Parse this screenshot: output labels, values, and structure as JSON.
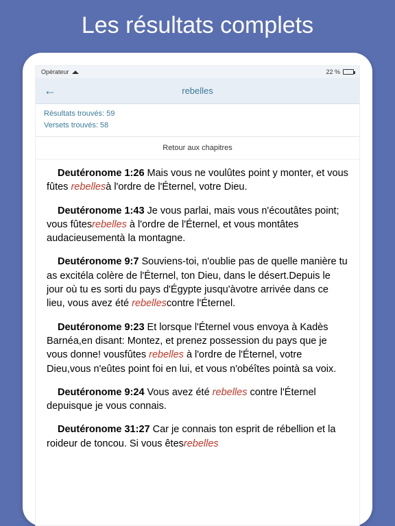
{
  "hero": {
    "title": "Les résultats complets"
  },
  "status": {
    "carrier": "Opérateur",
    "wifi": "wifi",
    "battery_text": "22 %"
  },
  "nav": {
    "back": "←",
    "title": "rebelles"
  },
  "stats": {
    "results": "Résultats trouvés: 59",
    "verses": "Versets trouvés: 58"
  },
  "return_link": "Retour aux chapitres",
  "keyword": "rebelles",
  "verses_list": [
    {
      "ref": "Deutéronome 1:26",
      "before": " Mais vous ne voulûtes point y monter, et vous fûtes ",
      "after": "à l'ordre de l'Éternel, votre Dieu."
    },
    {
      "ref": "Deutéronome 1:43",
      "before": " Je vous parlai, mais vous n'écoutâtes point; vous fûtes",
      "after": " à l'ordre de l'Éternel, et vous montâtes audacieusementà la montagne."
    },
    {
      "ref": "Deutéronome 9:7",
      "before": " Souviens-toi, n'oublie pas de quelle manière tu as excitéla colère de l'Éternel, ton Dieu, dans le désert.Depuis le jour où tu es sorti du pays d'Égypte jusqu'àvotre arrivée dans ce lieu, vous avez été ",
      "after": "contre l'Éternel."
    },
    {
      "ref": "Deutéronome 9:23",
      "before": " Et lorsque l'Éternel vous envoya à Kadès Barnéa,en disant: Montez, et prenez possession du pays que je vous donne! vousfûtes ",
      "after": " à l'ordre de l'Éternel, votre Dieu,vous n'eûtes point foi en lui, et vous n'obéîtes pointà sa voix."
    },
    {
      "ref": "Deutéronome 9:24",
      "before": " Vous avez été ",
      "after": " contre l'Éternel depuisque je vous connais."
    },
    {
      "ref": "Deutéronome 31:27",
      "before": " Car je connais ton esprit de rébellion et la roideur de toncou. Si vous êtes",
      "after": ""
    }
  ]
}
